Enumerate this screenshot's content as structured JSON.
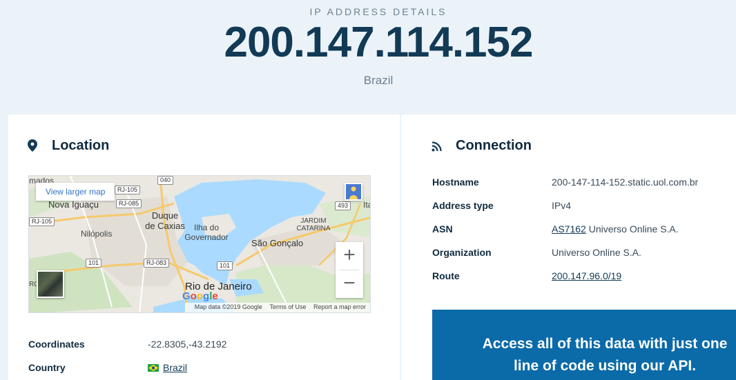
{
  "hero": {
    "kicker": "IP ADDRESS DETAILS",
    "ip": "200.147.114.152",
    "country": "Brazil"
  },
  "location": {
    "title": "Location",
    "icon": "map-pin-icon",
    "map": {
      "view_larger_label": "View larger map",
      "labels": {
        "amados": "mados",
        "nova_iguacu": "Nova Iguaçu",
        "duque_de_caxias": "Duque\nde Caxias",
        "ilha_do_governador": "Ilha do\nGovernador",
        "nilopolis": "Nilópolis",
        "jardim_catarina": "JARDIM\nCATARINA",
        "sao_goncalo": "São Gonçalo",
        "rio_de_janeiro": "Rio de Janeiro",
        "ita": "Ita",
        "ro": "RO"
      },
      "shields": {
        "rj105a": "RJ-105",
        "rj085": "RJ-085",
        "s040": "040",
        "rj105b": "RJ-105",
        "s101a": "101",
        "rj083": "RJ-083",
        "s101b": "101",
        "s493": "493"
      },
      "zoom_in": "+",
      "zoom_out": "−",
      "google": "Google",
      "footer": {
        "map_data": "Map data ©2019 Google",
        "terms": "Terms of Use",
        "report": "Report a map error"
      }
    },
    "fields": [
      {
        "label": "Coordinates",
        "value": "-22.8305,-43.2192"
      },
      {
        "label": "Country",
        "value": "Brazil"
      }
    ]
  },
  "connection": {
    "title": "Connection",
    "icon": "signal-icon",
    "fields": [
      {
        "label": "Hostname",
        "value": "200-147-114-152.static.uol.com.br"
      },
      {
        "label": "Address type",
        "value": "IPv4"
      },
      {
        "label": "ASN",
        "link": "AS7162",
        "value": " Universo Online S.A."
      },
      {
        "label": "Organization",
        "value": "Universo Online S.A."
      },
      {
        "label": "Route",
        "link": "200.147.96.0/19"
      }
    ]
  },
  "api_banner": {
    "line1": "Access all of this data with just one",
    "line2": "line of code using our API."
  },
  "colors": {
    "page_bg": "#ebf3f9",
    "heading": "#123a55",
    "banner": "#0b6aa8"
  }
}
